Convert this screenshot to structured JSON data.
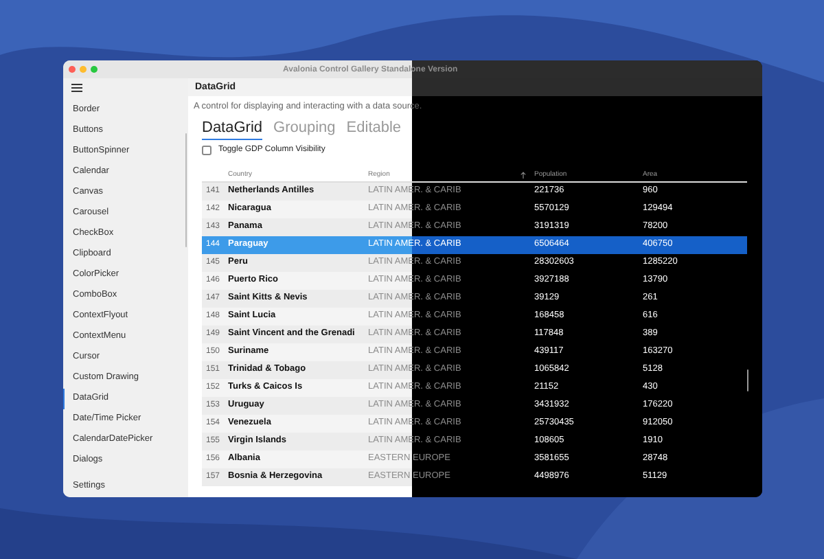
{
  "window": {
    "title": "Avalonia Control Gallery Standalone Version"
  },
  "sidebar": {
    "items": [
      {
        "label": "Border",
        "selected": false
      },
      {
        "label": "Buttons",
        "selected": false
      },
      {
        "label": "ButtonSpinner",
        "selected": false
      },
      {
        "label": "Calendar",
        "selected": false
      },
      {
        "label": "Canvas",
        "selected": false
      },
      {
        "label": "Carousel",
        "selected": false
      },
      {
        "label": "CheckBox",
        "selected": false
      },
      {
        "label": "Clipboard",
        "selected": false
      },
      {
        "label": "ColorPicker",
        "selected": false
      },
      {
        "label": "ComboBox",
        "selected": false
      },
      {
        "label": "ContextFlyout",
        "selected": false
      },
      {
        "label": "ContextMenu",
        "selected": false
      },
      {
        "label": "Cursor",
        "selected": false
      },
      {
        "label": "Custom Drawing",
        "selected": false
      },
      {
        "label": "DataGrid",
        "selected": true
      },
      {
        "label": "Date/Time Picker",
        "selected": false
      },
      {
        "label": "CalendarDatePicker",
        "selected": false
      },
      {
        "label": "Dialogs",
        "selected": false
      }
    ],
    "footer": "Settings"
  },
  "page": {
    "title": "DataGrid",
    "description": "A control for displaying and interacting with a data source.",
    "tabs": [
      {
        "label": "DataGrid",
        "selected": true
      },
      {
        "label": "Grouping",
        "selected": false
      },
      {
        "label": "Editable",
        "selected": false
      }
    ],
    "checkbox": {
      "label": "Toggle GDP Column Visibility",
      "checked": false
    }
  },
  "table": {
    "columns": [
      {
        "label": "Country",
        "sorted": false
      },
      {
        "label": "Region",
        "sorted": true
      },
      {
        "label": "Population",
        "sorted": false
      },
      {
        "label": "Area",
        "sorted": false
      }
    ],
    "rows": [
      {
        "number": "141",
        "cells": [
          "Netherlands Antilles",
          "LATIN AMER. & CARIB",
          "221736",
          "960"
        ],
        "selected": false
      },
      {
        "number": "142",
        "cells": [
          "Nicaragua",
          "LATIN AMER. & CARIB",
          "5570129",
          "129494"
        ],
        "selected": false
      },
      {
        "number": "143",
        "cells": [
          "Panama",
          "LATIN AMER. & CARIB",
          "3191319",
          "78200"
        ],
        "selected": false
      },
      {
        "number": "144",
        "cells": [
          "Paraguay",
          "LATIN AMER. & CARIB",
          "6506464",
          "406750"
        ],
        "selected": true
      },
      {
        "number": "145",
        "cells": [
          "Peru",
          "LATIN AMER. & CARIB",
          "28302603",
          "1285220"
        ],
        "selected": false
      },
      {
        "number": "146",
        "cells": [
          "Puerto Rico",
          "LATIN AMER. & CARIB",
          "3927188",
          "13790"
        ],
        "selected": false
      },
      {
        "number": "147",
        "cells": [
          "Saint Kitts & Nevis",
          "LATIN AMER. & CARIB",
          "39129",
          "261"
        ],
        "selected": false
      },
      {
        "number": "148",
        "cells": [
          "Saint Lucia",
          "LATIN AMER. & CARIB",
          "168458",
          "616"
        ],
        "selected": false
      },
      {
        "number": "149",
        "cells": [
          "Saint Vincent and the Grenadi",
          "LATIN AMER. & CARIB",
          "117848",
          "389"
        ],
        "selected": false
      },
      {
        "number": "150",
        "cells": [
          "Suriname",
          "LATIN AMER. & CARIB",
          "439117",
          "163270"
        ],
        "selected": false
      },
      {
        "number": "151",
        "cells": [
          "Trinidad & Tobago",
          "LATIN AMER. & CARIB",
          "1065842",
          "5128"
        ],
        "selected": false
      },
      {
        "number": "152",
        "cells": [
          "Turks & Caicos Is",
          "LATIN AMER. & CARIB",
          "21152",
          "430"
        ],
        "selected": false
      },
      {
        "number": "153",
        "cells": [
          "Uruguay",
          "LATIN AMER. & CARIB",
          "3431932",
          "176220"
        ],
        "selected": false
      },
      {
        "number": "154",
        "cells": [
          "Venezuela",
          "LATIN AMER. & CARIB",
          "25730435",
          "912050"
        ],
        "selected": false
      },
      {
        "number": "155",
        "cells": [
          "Virgin Islands",
          "LATIN AMER. & CARIB",
          "108605",
          "1910"
        ],
        "selected": false
      },
      {
        "number": "156",
        "cells": [
          "Albania",
          "EASTERN EUROPE",
          "3581655",
          "28748"
        ],
        "selected": false
      },
      {
        "number": "157",
        "cells": [
          "Bosnia & Herzegovina",
          "EASTERN EUROPE",
          "4498976",
          "51129"
        ],
        "selected": false
      }
    ]
  }
}
